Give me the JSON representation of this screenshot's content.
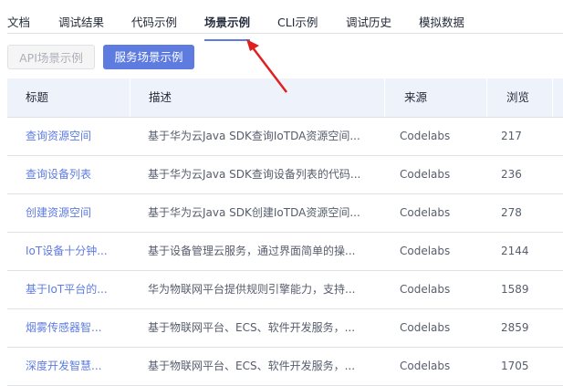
{
  "tabs": [
    "文档",
    "调试结果",
    "代码示例",
    "场景示例",
    "CLI示例",
    "调试历史",
    "模拟数据"
  ],
  "active_tab": "场景示例",
  "buttons": {
    "api": "API场景示例",
    "service": "服务场景示例"
  },
  "columns": [
    "标题",
    "描述",
    "来源",
    "浏览"
  ],
  "rows": [
    [
      "查询资源空间",
      "基于华为云Java SDK查询IoTDA资源空间...",
      "Codelabs",
      "217"
    ],
    [
      "查询设备列表",
      "基于华为云Java SDK查询设备列表的代码...",
      "Codelabs",
      "236"
    ],
    [
      "创建资源空间",
      "基于华为云Java SDK创建IoTDA资源空间...",
      "Codelabs",
      "278"
    ],
    [
      "IoT设备十分钟...",
      "基于设备管理云服务，通过界面简单的操...",
      "Codelabs",
      "2144"
    ],
    [
      "基于IoT平台的...",
      "华为物联网平台提供规则引擎能力，支持...",
      "Codelabs",
      "1589"
    ],
    [
      "烟雾传感器智...",
      "基于物联网平台、ECS、软件开发服务，...",
      "Codelabs",
      "2859"
    ],
    [
      "深度开发智慧...",
      "基于物联网平台、ECS、软件开发服务，...",
      "Codelabs",
      "1705"
    ]
  ],
  "colors": {
    "accent": "#5e7ce0",
    "arrow": "#e02020"
  }
}
